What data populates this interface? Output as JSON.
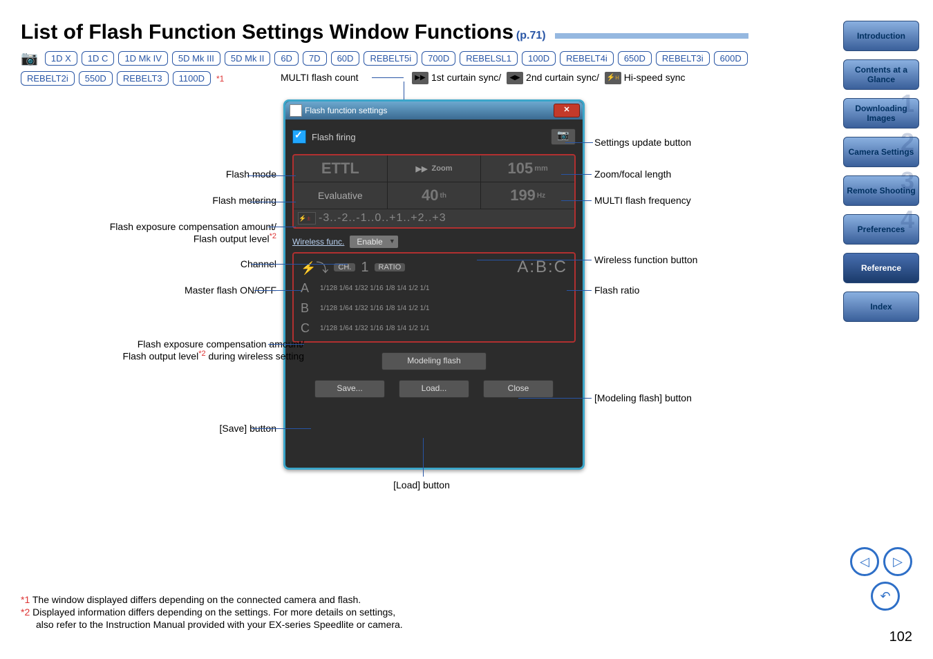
{
  "title": "List of Flash Function Settings Window Functions",
  "pageref": "(p.71)",
  "badges": [
    "1D X",
    "1D C",
    "1D Mk IV",
    "5D Mk III",
    "5D Mk II",
    "6D",
    "7D",
    "60D",
    "REBELT5i",
    "700D",
    "REBELSL1",
    "100D",
    "REBELT4i",
    "650D",
    "REBELT3i",
    "600D",
    "REBELT2i",
    "550D",
    "REBELT3",
    "1100D"
  ],
  "star1": "*1",
  "sync": {
    "multi": "MULTI flash count",
    "s1": "1st curtain sync/",
    "s2": "2nd curtain sync/",
    "s3": "Hi-speed sync"
  },
  "panel": {
    "title": "Flash function settings",
    "firing": "Flash firing",
    "ettl": "ETTL",
    "zoom": "Zoom",
    "zoomv": "105",
    "mm": "mm",
    "eval": "Evaluative",
    "forty": "40",
    "th": "th",
    "freq": "199",
    "hz": "Hz",
    "comp": "-3..-2..-1..0..+1..+2..+3",
    "wfunc": "Wireless func.",
    "enable": "Enable",
    "ch": "CH.",
    "chn": "1",
    "ratio": "RATIO",
    "abc": "A:B:C",
    "fracs": "1/128  1/64  1/32  1/16  1/8  1/4  1/2  1/1",
    "modeling": "Modeling flash",
    "save": "Save...",
    "load": "Load...",
    "close": "Close"
  },
  "labels": {
    "l_mode": "Flash mode",
    "l_metering": "Flash metering",
    "l_comp": "Flash exposure compensation amount/\nFlash output level",
    "l_comp_s": "*2",
    "l_channel": "Channel",
    "l_master": "Master flash ON/OFF",
    "l_comp2a": "Flash exposure compensation amount/",
    "l_comp2b": "Flash output level",
    "l_comp2s": "*2",
    "l_comp2c": " during wireless setting",
    "l_save": "[Save] button",
    "l_load": "[Load] button",
    "r_update": "Settings update button",
    "r_zoom": "Zoom/focal length",
    "r_freq": "MULTI flash frequency",
    "r_wfunc": "Wireless function button",
    "r_ratio": "Flash ratio",
    "r_model": "[Modeling flash] button"
  },
  "footnotes": {
    "f1": "The window displayed differs depending on the connected camera and flash.",
    "f2a": "Displayed information differs depending on the settings. For more details on settings,",
    "f2b": "also refer to the Instruction Manual provided with your EX-series Speedlite or camera."
  },
  "sidebar": [
    "Introduction",
    "Contents at a Glance",
    "Downloading Images",
    "Camera Settings",
    "Remote Shooting",
    "Preferences",
    "Reference",
    "Index"
  ],
  "pagenum": "102"
}
